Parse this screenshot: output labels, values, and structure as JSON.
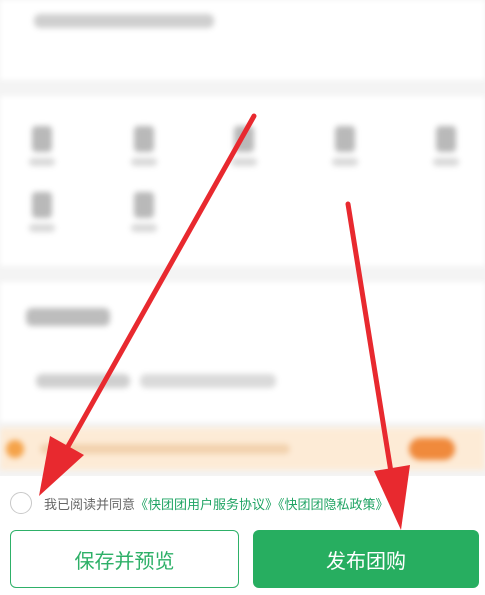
{
  "agreement": {
    "prefix": "我已阅读并同意",
    "link1": "《快团团用户服务协议》",
    "link2": "《快团团隐私政策》"
  },
  "buttons": {
    "save_preview": "保存并预览",
    "publish": "发布团购"
  },
  "colors": {
    "brand_green": "#27ae60",
    "arrow_red": "#e8292f",
    "banner_bg": "#fdebd6"
  }
}
